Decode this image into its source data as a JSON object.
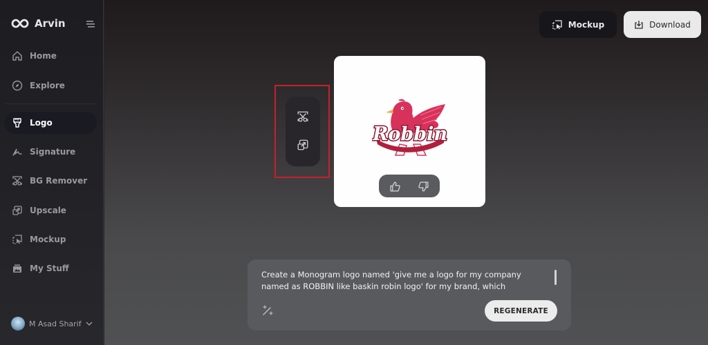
{
  "app": {
    "brand_name": "Arvin",
    "brand_icon": "infinity-logo-icon"
  },
  "sidebar": {
    "menu_icon": "hamburger-icon",
    "items": [
      {
        "label": "Home",
        "icon": "home-icon",
        "active": false
      },
      {
        "label": "Explore",
        "icon": "compass-icon",
        "active": false
      },
      {
        "label": "Logo",
        "icon": "brush-icon",
        "active": true
      },
      {
        "label": "Signature",
        "icon": "signature-icon",
        "active": false
      },
      {
        "label": "BG Remover",
        "icon": "scissors-icon",
        "active": false
      },
      {
        "label": "Upscale",
        "icon": "upscale-icon",
        "active": false
      },
      {
        "label": "Mockup",
        "icon": "mockup-icon",
        "active": false
      },
      {
        "label": "My Stuff",
        "icon": "image-stack-icon",
        "active": false
      }
    ],
    "user": {
      "name": "M Asad Sharif",
      "icon": "chevron-down-icon"
    }
  },
  "toolbar": {
    "mockup_label": "Mockup",
    "download_label": "Download"
  },
  "tools": [
    {
      "name": "bg-remover",
      "icon": "scissors-icon"
    },
    {
      "name": "upscale",
      "icon": "upscale-icon"
    }
  ],
  "result": {
    "logo_text": "Robbin",
    "feedback": [
      "thumbs-up-icon",
      "thumbs-down-icon"
    ],
    "colors": {
      "primary": "#d8315b",
      "accent": "#f2a33a"
    }
  },
  "prompt": {
    "text": "Create a Monogram logo named 'give me a logo for my company named  as ROBBIN like baskin robin logo' for my brand, which",
    "regenerate_label": "REGENERATE",
    "magic_icon": "magic-wand-icon"
  },
  "highlight": {
    "color": "#c8202a"
  }
}
